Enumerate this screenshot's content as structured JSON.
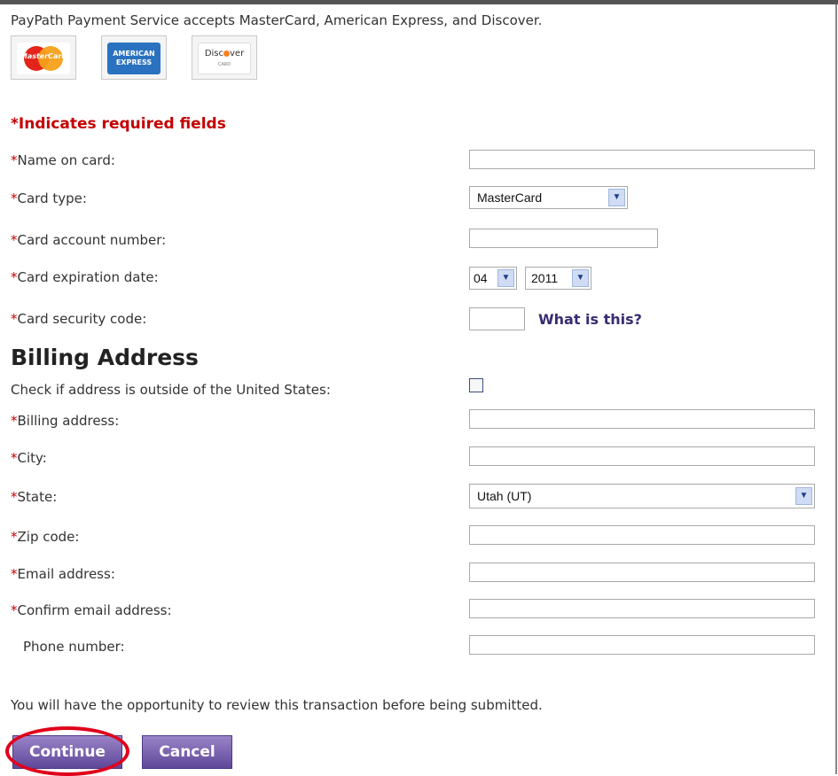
{
  "intro": "PayPath Payment Service accepts MasterCard, American Express, and Discover.",
  "card_logos": {
    "mastercard": "MasterCard",
    "amex_line1": "AMERICAN",
    "amex_line2": "EXPRESS",
    "discover_a": "Disc",
    "discover_b": "ver",
    "discover_sub": "CARD"
  },
  "required_note": "*Indicates required fields",
  "required_marker": "*",
  "labels": {
    "name_on_card": "Name on card:",
    "card_type": "Card type:",
    "card_account_number": "Card account number:",
    "card_expiration_date": "Card expiration date:",
    "card_security_code": "Card security code:",
    "outside_us": "Check if address is outside of the United States:",
    "billing_address": "Billing address:",
    "city": "City:",
    "state": "State:",
    "zip_code": "Zip code:",
    "email_address": "Email address:",
    "confirm_email_address": "Confirm email address:",
    "phone_number": "Phone number:"
  },
  "values": {
    "card_type": "MasterCard",
    "exp_month": "04",
    "exp_year": "2011",
    "state": "Utah (UT)"
  },
  "what_is_this": "What is this?",
  "billing_heading": "Billing Address",
  "review_note": "You will have the opportunity to review this transaction before being submitted.",
  "buttons": {
    "continue": "Continue",
    "cancel": "Cancel"
  },
  "colors": {
    "required": "#c40000",
    "button": "#6a53a3",
    "highlight": "#e0001b"
  }
}
